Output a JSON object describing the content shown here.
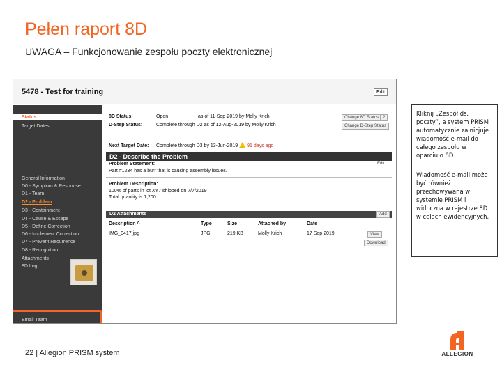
{
  "slide": {
    "title": "Pełen raport 8D",
    "subtitle": "UWAGA – Funkcjonowanie zespołu poczty elektronicznej",
    "footer": "22 | Allegion PRISM system",
    "logo_text": "ALLEGION"
  },
  "colors": {
    "accent": "#f26522",
    "sidebar": "#3a3a3a",
    "section": "#333333"
  },
  "screen": {
    "title": "5478 - Test for training",
    "edit_label": "Edit",
    "sidebar": {
      "status": "Status",
      "items": [
        "Target Dates",
        "General Information",
        "D0 - Symptom & Response",
        "D1 - Team",
        "D2 - Problem",
        "D3 - Containment",
        "D4 - Cause & Escape",
        "D5 - Define Correction",
        "D6 - Implement Correction",
        "D7 - Prevent Recurrence",
        "D8 - Recognition",
        "Attachments",
        "8D Log"
      ],
      "email_team": "Email Team"
    },
    "status_panel": {
      "status_label": "8D Status:",
      "status_value": "Open",
      "status_as_of": "as of 11-Sep-2019 by Molly Krich",
      "change_status": "Change 8D Status",
      "help": "?",
      "step_label": "D-Step Status:",
      "step_value": "Complete through D2 as of 12-Aug-2019 by",
      "step_user": "Molly Krich",
      "change_step": "Change D-Step Status",
      "target_label": "Next Target Date:",
      "target_value": "Complete through D3 by 13-Jun-2019",
      "overdue": "91 days ago"
    },
    "d2": {
      "header": "D2 - Describe the Problem",
      "statement_label": "Problem Statement:",
      "edit": "Edit",
      "statement_value": "Part #1234 has a burr that is causing assembly issues.",
      "description_label": "Problem Description:",
      "description_line1": "100% of parts in lot XY7 shipped on 7/7/2019",
      "description_line2": "Total quantity is 1,200"
    },
    "attachments": {
      "header": "D2 Attachments",
      "add": "Add",
      "columns": [
        "Description ^",
        "Type",
        "Size",
        "Attached by",
        "Date"
      ],
      "row": {
        "description": "IMG_0417.jpg",
        "type": "JPG",
        "size": "219 KB",
        "attached_by": "Molly Krich",
        "date": "17 Sep 2019",
        "view": "View",
        "download": "Download"
      }
    }
  },
  "callout": {
    "text1": "Kliknij „Zespół ds.\npoczty”, a system PRISM\nautomatycznie zainicjuje\nwiadomość e-mail do\ncałego zespołu w\noparciu o 8D.",
    "text2": "Wiadomość e-mail może\nbyć również\nprzechowywana w\nsystemie PRISM i\nwidoczna w rejestrze 8D\nw celach ewidencyjnych."
  }
}
